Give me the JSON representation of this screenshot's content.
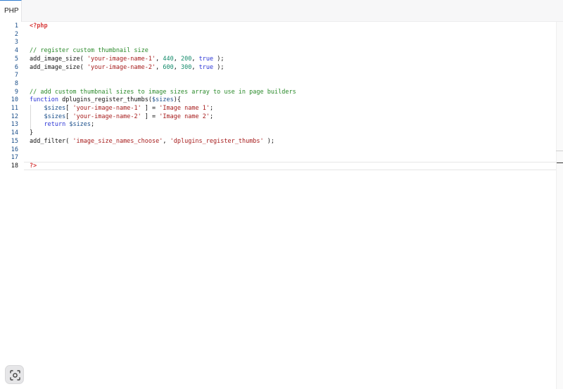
{
  "tab": {
    "label": "PHP"
  },
  "editor": {
    "active_line": 18,
    "lines": [
      {
        "n": "1"
      },
      {
        "n": "2"
      },
      {
        "n": "3"
      },
      {
        "n": "4"
      },
      {
        "n": "5"
      },
      {
        "n": "6"
      },
      {
        "n": "7"
      },
      {
        "n": "8"
      },
      {
        "n": "9"
      },
      {
        "n": "10"
      },
      {
        "n": "11"
      },
      {
        "n": "12"
      },
      {
        "n": "13"
      },
      {
        "n": "14"
      },
      {
        "n": "15"
      },
      {
        "n": "16"
      },
      {
        "n": "17"
      },
      {
        "n": "18"
      }
    ],
    "code": {
      "l1_tag": "<?php",
      "l4_comment": "// register custom thumbnail size",
      "l5_fn": "add_image_size( ",
      "l5_str": "'your-image-name-1'",
      "l5_sep1": ", ",
      "l5_num1": "440",
      "l5_sep2": ", ",
      "l5_num2": "200",
      "l5_sep3": ", ",
      "l5_kw": "true",
      "l5_end": " );",
      "l6_fn": "add_image_size( ",
      "l6_str": "'your-image-name-2'",
      "l6_sep1": ", ",
      "l6_num1": "600",
      "l6_sep2": ", ",
      "l6_num2": "300",
      "l6_sep3": ", ",
      "l6_kw": "true",
      "l6_end": " );",
      "l9_comment": "// add custom thumbnail sizes to image sizes array to use in page builders",
      "l10_kw": "function",
      "l10_name": " dplugins_register_thumbs(",
      "l10_var": "$sizes",
      "l10_end": "){",
      "l11_indent": "    ",
      "l11_var": "$sizes",
      "l11_open": "[ ",
      "l11_key": "'your-image-name-1'",
      "l11_mid": " ] = ",
      "l11_val": "'Image name 1'",
      "l11_end": ";",
      "l12_indent": "    ",
      "l12_var": "$sizes",
      "l12_open": "[ ",
      "l12_key": "'your-image-name-2'",
      "l12_mid": " ] = ",
      "l12_val": "'Image name 2'",
      "l12_end": ";",
      "l13_indent": "    ",
      "l13_kw": "return",
      "l13_sp": " ",
      "l13_var": "$sizes",
      "l13_end": ";",
      "l14_text": "}",
      "l15_fn": "add_filter( ",
      "l15_str1": "'image_size_names_choose'",
      "l15_sep": ", ",
      "l15_str2": "'dplugins_register_thumbs'",
      "l15_end": " );",
      "l18_tag": "?>"
    }
  },
  "icons": {
    "capture": "screenshot-capture-icon"
  },
  "colors": {
    "tab_accent": "#2e7bcf",
    "php_tag": "#d73a3a",
    "comment": "#2a8a2a",
    "string": "#a61b1b",
    "number": "#128a6a",
    "keyword": "#2a34d6",
    "variable": "#1a4e8a"
  }
}
